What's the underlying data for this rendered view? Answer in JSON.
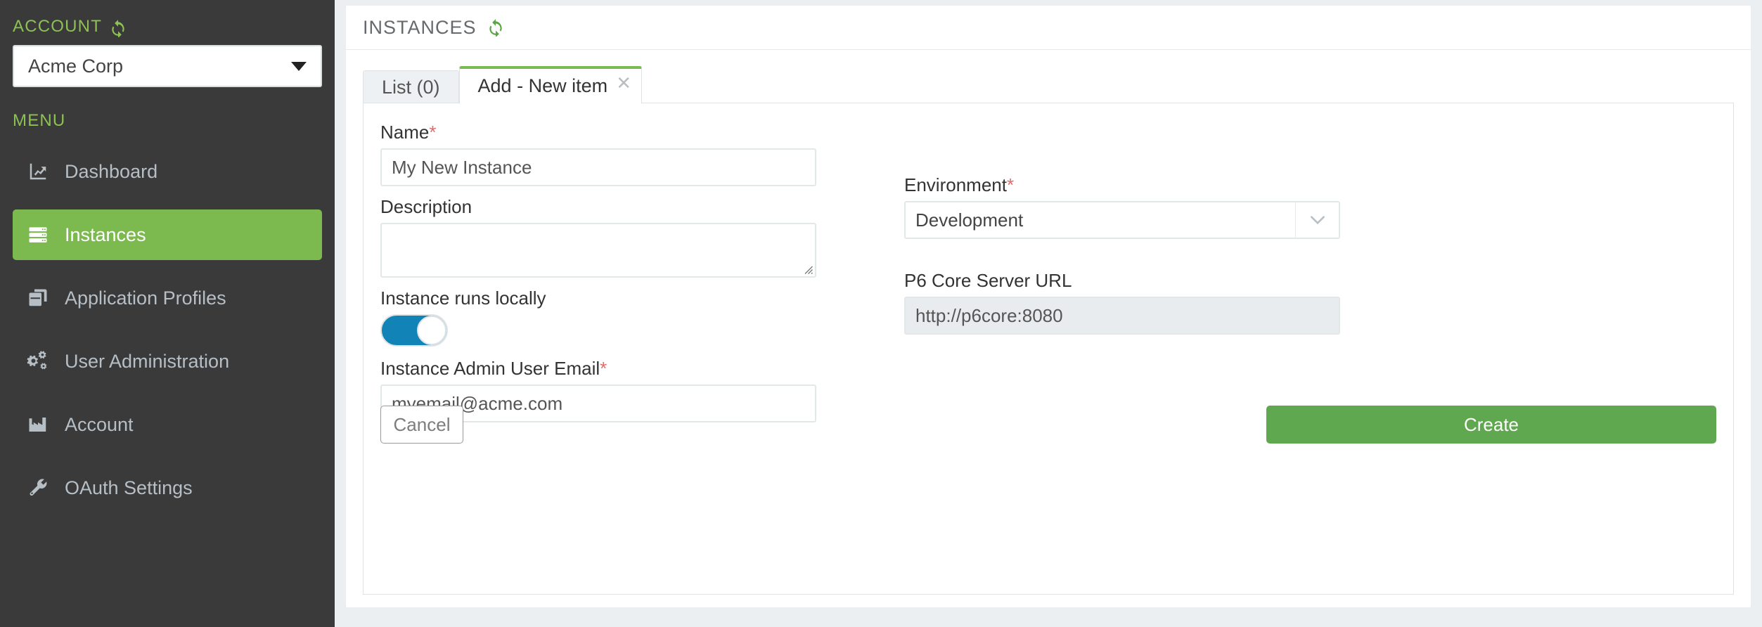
{
  "sidebar": {
    "account_label": "ACCOUNT",
    "account_refresh_icon": "refresh-icon",
    "account_value": "Acme Corp",
    "menu_label": "MENU",
    "items": [
      {
        "label": "Dashboard",
        "icon": "chart-line-icon",
        "active": false
      },
      {
        "label": "Instances",
        "icon": "server-icon",
        "active": true
      },
      {
        "label": "Application Profiles",
        "icon": "clone-icon",
        "active": false
      },
      {
        "label": "User Administration",
        "icon": "gears-icon",
        "active": false
      },
      {
        "label": "Account",
        "icon": "factory-icon",
        "active": false
      },
      {
        "label": "OAuth Settings",
        "icon": "wrench-icon",
        "active": false
      }
    ]
  },
  "header": {
    "title": "INSTANCES",
    "refresh_icon": "refresh-icon"
  },
  "tabs": [
    {
      "label": "List (0)",
      "active": false,
      "closable": false
    },
    {
      "label": "Add - New item",
      "active": true,
      "closable": true,
      "close_icon": "close-icon"
    }
  ],
  "form": {
    "name": {
      "label": "Name",
      "required": "*",
      "value": "My New Instance"
    },
    "description": {
      "label": "Description",
      "value": ""
    },
    "environment": {
      "label": "Environment",
      "required": "*",
      "value": "Development",
      "chevron_icon": "chevron-down-icon"
    },
    "runs_locally": {
      "label": "Instance runs locally",
      "state": "on"
    },
    "p6_core_url": {
      "label": "P6 Core Server URL",
      "value": "http://p6core:8080",
      "disabled": true
    },
    "admin_email": {
      "label": "Instance Admin User Email",
      "required": "*",
      "value": "myemail@acme.com"
    }
  },
  "actions": {
    "cancel_label": "Cancel",
    "create_label": "Create"
  },
  "colors": {
    "brand_green": "#7cb94e",
    "create_green": "#60a84f",
    "sidebar_bg": "#3a3a3a",
    "toggle_on": "#1283b6",
    "required_red": "#e06b6b",
    "page_bg": "#eceff1"
  }
}
